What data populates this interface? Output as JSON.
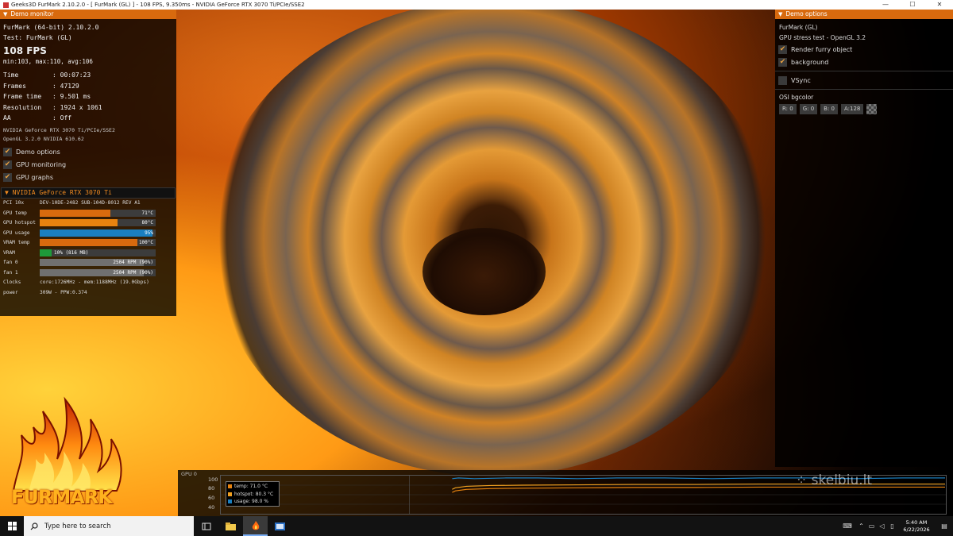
{
  "window": {
    "title": "Geeks3D FurMark 2.10.2.0 - [ FurMark (GL) ] - 108 FPS, 9.350ms - NVIDIA GeForce RTX 3070 Ti/PCIe/SSE2",
    "controls": {
      "minimize": "—",
      "maximize": "☐",
      "close": "✕"
    }
  },
  "demo_monitor": {
    "header": "Demo monitor",
    "app_name": "FurMark (64-bit) 2.10.2.0",
    "test": "Test: FurMark (GL)",
    "fps": "108 FPS",
    "fps_stats": "min:103, max:110, avg:106",
    "stats": [
      {
        "key": "Time",
        "value": ": 00:07:23"
      },
      {
        "key": "Frames",
        "value": ": 47129"
      },
      {
        "key": "Frame time",
        "value": ": 9.501 ms"
      },
      {
        "key": "Resolution",
        "value": ": 1924 x 1061"
      },
      {
        "key": "AA",
        "value": ": Off"
      }
    ],
    "renderer": "NVIDIA GeForce RTX 3070 Ti/PCIe/SSE2",
    "opengl": "OpenGL 3.2.0 NVIDIA 610.62",
    "checkboxes": [
      {
        "label": "Demo options",
        "checked": true
      },
      {
        "label": "GPU monitoring",
        "checked": true
      },
      {
        "label": "GPU graphs",
        "checked": true
      }
    ]
  },
  "gpu_monitor": {
    "header": "NVIDIA GeForce RTX 3070 Ti",
    "pci": {
      "key": "PCI 10x",
      "value": "DEV-10DE-2482 SUB-104D-8012 REV A1"
    },
    "bars": [
      {
        "key": "GPU temp",
        "text": "71°C",
        "level": 0.61,
        "color": "#d86a0e"
      },
      {
        "key": "GPU hotspot",
        "text": "80°C",
        "level": 0.67,
        "color": "#e8830f"
      },
      {
        "key": "GPU usage",
        "text": "95%",
        "level": 0.97,
        "color": "#1a7fc0"
      },
      {
        "key": "VRAM temp",
        "text": "100°C",
        "level": 0.84,
        "color": "#d86a0e"
      },
      {
        "key": "VRAM",
        "text": "10% (816 MB)",
        "level": 0.1,
        "color": "#1e9a3a"
      },
      {
        "key": "fan 0",
        "text": "2504 RPM (90%)",
        "level": 0.9,
        "color": "#707070"
      },
      {
        "key": "fan 1",
        "text": "2504 RPM (90%)",
        "level": 0.9,
        "color": "#707070"
      }
    ],
    "clocks": {
      "key": "Clocks",
      "value": "core:1726MHz - mem:1188MHz (19.0Gbps)"
    },
    "power": {
      "key": "power",
      "value": "309W - PPW:0.374"
    }
  },
  "logo": {
    "text": "FURMARK"
  },
  "demo_options": {
    "header": "Demo options",
    "name": "FurMark (GL)",
    "subtitle": "GPU stress test - OpenGL 3.2",
    "checkboxes": [
      {
        "label": "Render furry object",
        "checked": true
      },
      {
        "label": "background",
        "checked": true
      }
    ],
    "vsync": {
      "label": "VSync",
      "checked": false
    },
    "osi_label": "OSI bgcolor",
    "bgcolor": {
      "r": "R: 0",
      "g": "G: 0",
      "b": "B: 0",
      "a": "A:128"
    }
  },
  "graph": {
    "title": "GPU 0",
    "y_ticks": [
      "100",
      "80",
      "60",
      "40"
    ],
    "legend": [
      {
        "label": "temp: 71.0 °C",
        "color": "#e8830f"
      },
      {
        "label": "hotspot: 80.3 °C",
        "color": "#f0a020"
      },
      {
        "label": "usage: 98.0 %",
        "color": "#1a7fc0"
      }
    ]
  },
  "watermark": "skelbiu.lt",
  "taskbar": {
    "search_placeholder": "Type here to search",
    "time": "5:40 AM",
    "date": "6/22/2026"
  }
}
